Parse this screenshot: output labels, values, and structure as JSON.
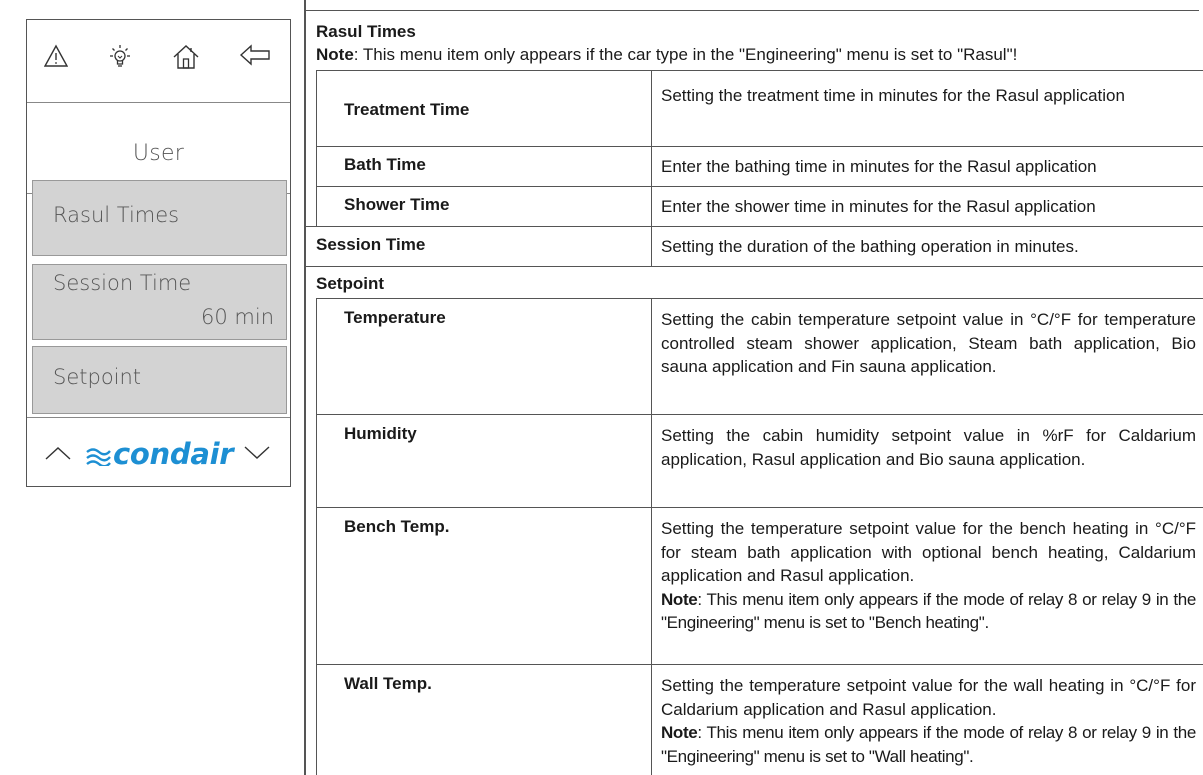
{
  "device": {
    "title": "User",
    "menu": [
      {
        "label": "Rasul Times",
        "value": ""
      },
      {
        "label": "Session Time",
        "value": "60 min"
      },
      {
        "label": "Setpoint",
        "value": ""
      }
    ],
    "logo_text": "condair"
  },
  "doc": {
    "section_title": "Rasul Times",
    "note_bold": "Note",
    "note_text": ": This menu item only appears if the car type in the \"Engineering\" menu is set to \"Rasul\"!",
    "rows": [
      {
        "label": "Treatment Time",
        "desc": "Setting the treatment time in minutes for the Rasul ap­plication"
      },
      {
        "label": "Bath Time",
        "desc": "Enter the bathing time in minutes for the Rasul application"
      },
      {
        "label": "Shower Time",
        "desc": "Enter the shower time in minutes for the Rasul application"
      },
      {
        "label": "Session Time",
        "desc": "Setting the duration of the bathing operation in minutes."
      },
      {
        "label": "Setpoint",
        "desc": ""
      },
      {
        "label": "Temperature",
        "desc": "Setting the cabin temperature setpoint value in °C/°F for temperature controlled steam shower application, Steam bath application, Bio sauna application and Fin sauna application."
      },
      {
        "label": "Humidity",
        "desc": "Setting the cabin humidity setpoint value in %rF for Caldarium application, Rasul application and Bio sauna application."
      },
      {
        "label": "Bench Temp.",
        "desc": "Setting the temperature setpoint value for the bench heat­ing in °C/°F for steam bath application with optional bench heating, Caldarium application and Rasul application.",
        "note_bold": "Note",
        "note": ": This menu item only appears if the mode of relay 8 or relay 9 in the \"Engineering\" menu is set to \"Bench heating\"."
      },
      {
        "label": "Wall Temp.",
        "desc": "Setting the temperature setpoint value for the wall heating in °C/°F for Caldarium application and Rasul application.",
        "note_bold": "Note",
        "note": ": This menu item only appears if the mode of relay 8 or relay 9 in the \"Engineering\" menu is set to \"Wall heating\"."
      }
    ]
  }
}
